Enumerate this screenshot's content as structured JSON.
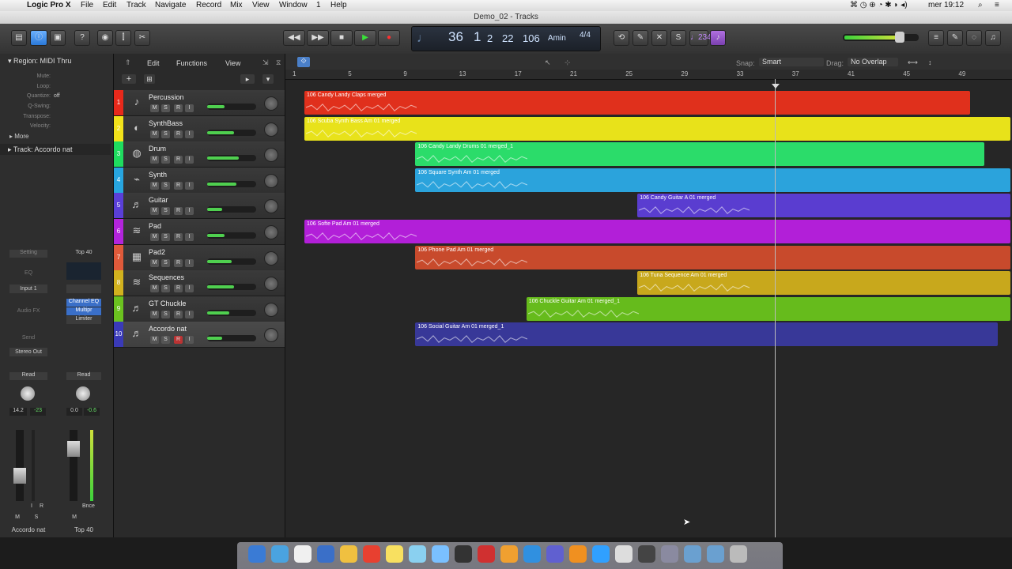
{
  "menubar": {
    "apple": "",
    "app": "Logic Pro X",
    "items": [
      "File",
      "Edit",
      "Track",
      "Navigate",
      "Record",
      "Mix",
      "View",
      "Window",
      "1",
      "Help"
    ],
    "clock": "mer 19:12"
  },
  "window": {
    "title": "Demo_02 - Tracks"
  },
  "lcd": {
    "bar": "36",
    "beat": "1",
    "div": "2",
    "tick": "22",
    "tempo": "106",
    "key": "Amin",
    "sig": "4/4"
  },
  "cycle_display": "♩234",
  "arrange_toolbar": {
    "edit": "Edit",
    "functions": "Functions",
    "view": "View",
    "snap_label": "Snap:",
    "snap_value": "Smart",
    "drag_label": "Drag:",
    "drag_value": "No Overlap"
  },
  "inspector": {
    "region_header": "Region: MIDI Thru",
    "rows": [
      {
        "k": "Mute:",
        "v": ""
      },
      {
        "k": "Loop:",
        "v": ""
      },
      {
        "k": "Quantize:",
        "v": "off"
      },
      {
        "k": "Q-Swing:",
        "v": ""
      },
      {
        "k": "Transpose:",
        "v": ""
      },
      {
        "k": "Velocity:",
        "v": ""
      }
    ],
    "more": "More",
    "track_header": "Track:  Accordo nat",
    "strip1": {
      "setting": "Setting",
      "eq": "EQ",
      "input": "Input 1",
      "fx": "Audio FX",
      "send": "Send",
      "output": "Stereo Out",
      "auto": "Read",
      "val1": "14.2",
      "val2": "-23",
      "name": "Accordo nat",
      "m": "M",
      "s": "S",
      "i": "I",
      "r": "R"
    },
    "strip2": {
      "setting": "Top 40",
      "fx": [
        "Channel EQ",
        "Multipr",
        "Limiter"
      ],
      "auto": "Read",
      "val1": "0.0",
      "val2": "-0.6",
      "bnce": "Bnce",
      "name": "Top 40",
      "m": "M"
    }
  },
  "ruler": [
    "1",
    "5",
    "9",
    "13",
    "17",
    "21",
    "25",
    "29",
    "33",
    "37",
    "41",
    "45",
    "49"
  ],
  "tracks": [
    {
      "num": "1",
      "name": "Percussion",
      "color": "#e8291b",
      "icon": "♪",
      "vol": 0.35
    },
    {
      "num": "2",
      "name": "SynthBass",
      "color": "#f2e21a",
      "icon": "◐",
      "vol": 0.55
    },
    {
      "num": "3",
      "name": "Drum",
      "color": "#1fdc5f",
      "icon": "◍",
      "vol": 0.65
    },
    {
      "num": "4",
      "name": "Synth",
      "color": "#27a5e0",
      "icon": "⌁",
      "vol": 0.6
    },
    {
      "num": "5",
      "name": "Guitar",
      "color": "#5a3fd8",
      "icon": "♬",
      "vol": 0.3
    },
    {
      "num": "6",
      "name": "Pad",
      "color": "#b324dc",
      "icon": "≋",
      "vol": 0.35
    },
    {
      "num": "7",
      "name": "Pad2",
      "color": "#e05a3a",
      "icon": "▦",
      "vol": 0.5
    },
    {
      "num": "8",
      "name": "Sequences",
      "color": "#d2b21e",
      "icon": "≋",
      "vol": 0.55
    },
    {
      "num": "9",
      "name": "GT Chuckle",
      "color": "#6bc21f",
      "icon": "♬",
      "vol": 0.45
    },
    {
      "num": "10",
      "name": "Accordo nat",
      "color": "#3a3ab8",
      "icon": "♬",
      "vol": 0.3
    }
  ],
  "regions": [
    {
      "label": "106 Candy Landy Claps merged",
      "start": 1,
      "end": 49,
      "track": 0,
      "color": "#e0301c"
    },
    {
      "label": "106 Scuba Synth Bass Am 01 merged",
      "start": 1,
      "end": 52,
      "track": 1,
      "color": "#e8e21a"
    },
    {
      "label": "106 Candy Landy Drums 01 merged_1",
      "start": 9,
      "end": 50,
      "track": 2,
      "color": "#2bdc6a"
    },
    {
      "label": "106 Square Synth Am 01 merged",
      "start": 9,
      "end": 52,
      "track": 3,
      "color": "#2ba3dc"
    },
    {
      "label": "106 Candy Guitar A 01 merged",
      "start": 25,
      "end": 52,
      "track": 4,
      "color": "#5a3dd0"
    },
    {
      "label": "106 Softe Pad Am 01 merged",
      "start": 1,
      "end": 52,
      "track": 5,
      "color": "#b21fd8"
    },
    {
      "label": "106 Phone Pad Am 01 merged",
      "start": 9,
      "end": 52,
      "track": 6,
      "color": "#c84a2c"
    },
    {
      "label": "106 Tuna Sequence Am 01 merged",
      "start": 25,
      "end": 52,
      "track": 7,
      "color": "#c8a81c"
    },
    {
      "label": "106 Chuckle Guitar Am 01 merged_1",
      "start": 17,
      "end": 52,
      "track": 8,
      "color": "#66bb1c"
    },
    {
      "label": "106 Social Guitar Am 01 merged_1",
      "start": 9,
      "end": 51,
      "track": 9,
      "color": "#383898"
    }
  ]
}
